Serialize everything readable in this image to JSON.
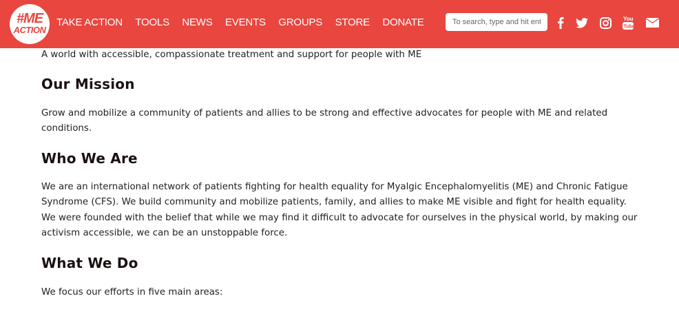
{
  "header": {
    "logo": {
      "line1": "#ME",
      "line2": "ACTION"
    },
    "nav": [
      "TAKE ACTION",
      "TOOLS",
      "NEWS",
      "EVENTS",
      "GROUPS",
      "STORE",
      "DONATE"
    ],
    "search_placeholder": "To search, type and hit enter",
    "social_icons": [
      "facebook-icon",
      "twitter-icon",
      "instagram-icon",
      "youtube-icon",
      "email-icon"
    ],
    "colors": {
      "bar": "#e8463f",
      "text": "#ffffff"
    }
  },
  "content": {
    "vision_text": "A world with accessible, compassionate treatment and support for people with ME",
    "mission_heading": "Our Mission",
    "mission_text": "Grow and mobilize a community of patients and allies to be strong and effective advocates for people with ME and related conditions.",
    "who_heading": "Who We Are",
    "who_text": "We are an international network of patients fighting for health equality for Myalgic Encephalomyelitis (ME) and Chronic Fatigue Syndrome (CFS). We build community and mobilize patients, family, and allies to make ME visible and fight for health equality. We were founded with the belief that while we may find it difficult to advocate for ourselves in the physical world, by making our activism accessible, we can be an unstoppable force.",
    "what_heading": "What We Do",
    "what_text": "We focus our efforts in five main areas:"
  }
}
